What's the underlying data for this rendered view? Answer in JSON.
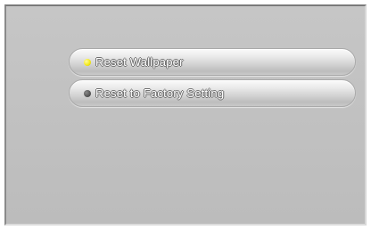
{
  "menu": {
    "items": [
      {
        "label": "Reset Wallpaper",
        "indicator": "active-dot-icon",
        "indicator_color": "#f3ea1c"
      },
      {
        "label": "Reset to Factory Setting",
        "indicator": "inactive-dot-icon",
        "indicator_color": "#555555"
      }
    ]
  },
  "colors": {
    "background": "#c0c0c0",
    "active_indicator": "#f3ea1c",
    "inactive_indicator": "#555555",
    "label_text": "#ffffff"
  }
}
